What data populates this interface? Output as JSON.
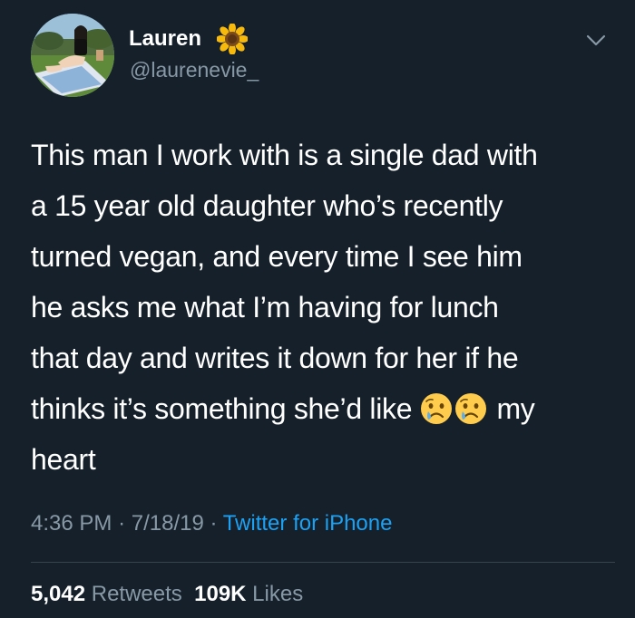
{
  "author": {
    "display_name": "Lauren",
    "handle": "@laurenevie_",
    "avatar_icon": "profile-photo",
    "name_emoji_icon": "sunflower-icon"
  },
  "tweet": {
    "text_lines": [
      "This man I work with is a single dad with",
      "a 15 year old daughter who’s recently",
      "turned vegan, and every time I see him",
      "he asks me what I’m having for lunch",
      "that day and writes it down for her if he",
      "thinks it’s something she’d like",
      "heart"
    ],
    "after_emoji_text": "my",
    "emoji_icon": "crying-face-icon"
  },
  "meta": {
    "time": "4:36 PM",
    "separator": "·",
    "date": "7/18/19",
    "source": "Twitter for iPhone"
  },
  "stats": {
    "retweets_count": "5,042",
    "retweets_label": "Retweets",
    "likes_count": "109K",
    "likes_label": "Likes"
  },
  "colors": {
    "background": "#15202b",
    "text": "#ffffff",
    "secondary": "#8899a6",
    "link": "#1da1f2",
    "divider": "#38444d"
  }
}
